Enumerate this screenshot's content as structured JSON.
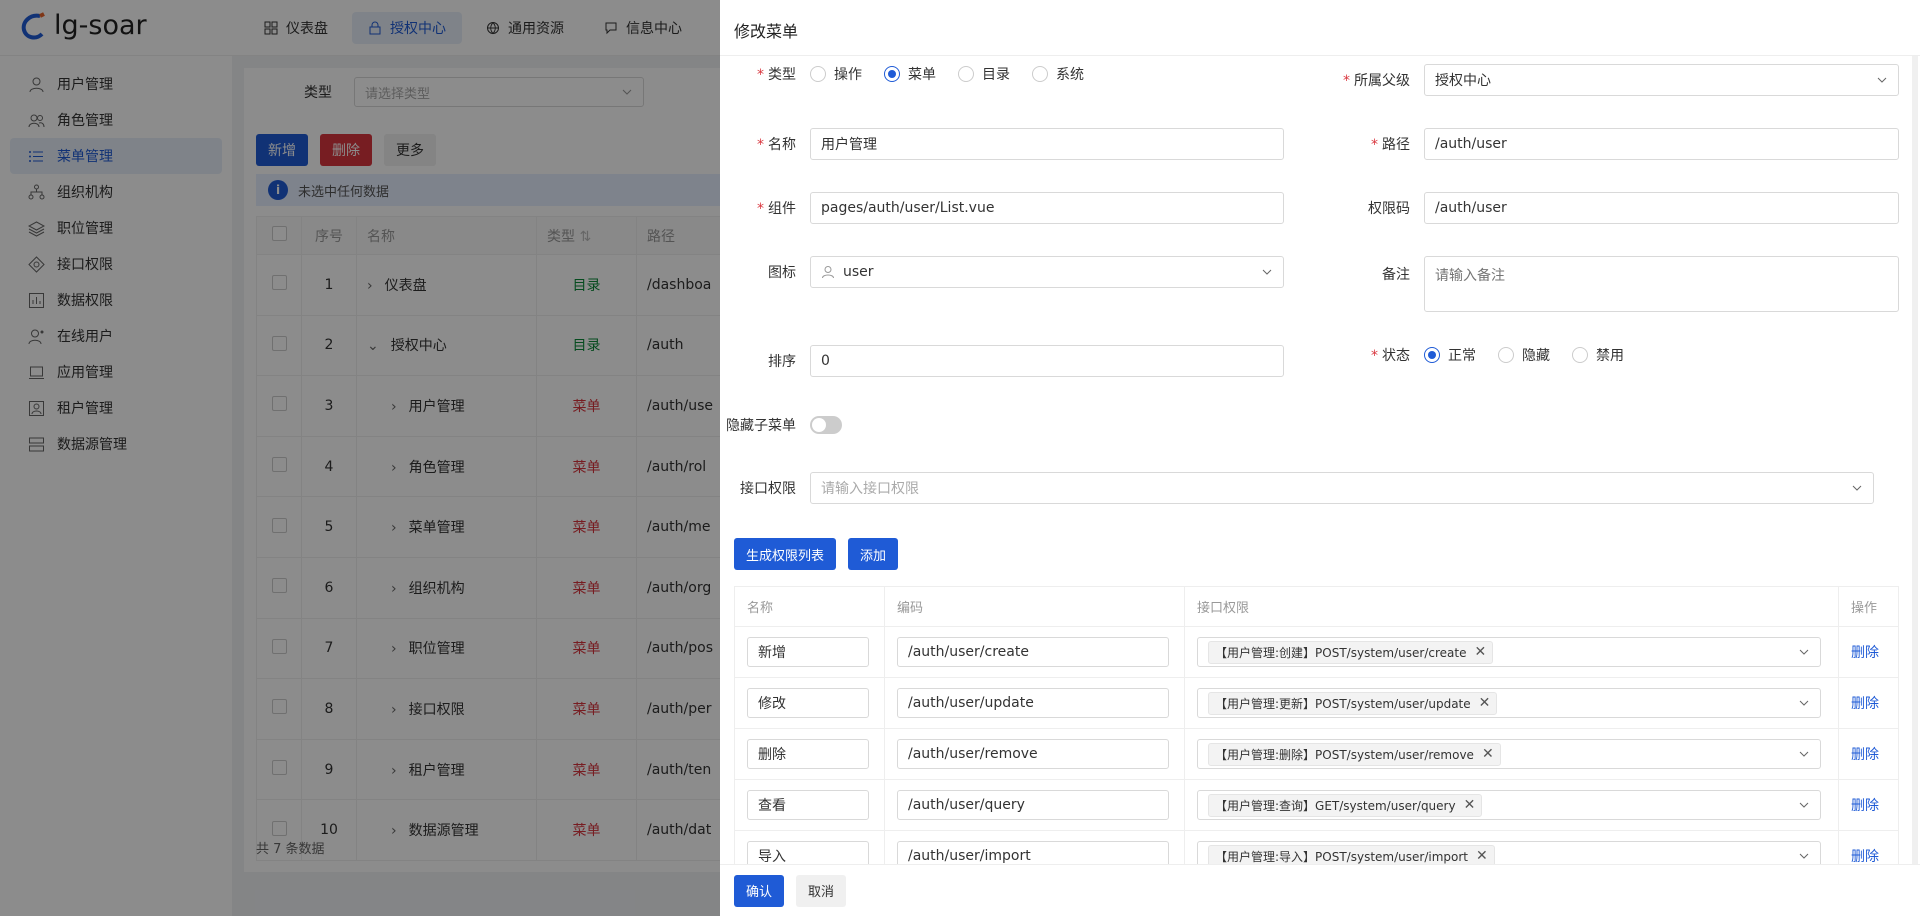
{
  "app": {
    "logo_text": "lg-soar"
  },
  "top_nav": [
    {
      "label": "仪表盘",
      "icon": "dashboard-icon"
    },
    {
      "label": "授权中心",
      "icon": "lock-icon",
      "active": true
    },
    {
      "label": "通用资源",
      "icon": "globe-icon"
    },
    {
      "label": "信息中心",
      "icon": "message-icon"
    }
  ],
  "sidebar": {
    "items": [
      {
        "label": "用户管理",
        "icon": "user-icon"
      },
      {
        "label": "角色管理",
        "icon": "users-icon"
      },
      {
        "label": "菜单管理",
        "icon": "list-icon",
        "active": true
      },
      {
        "label": "组织机构",
        "icon": "org-icon"
      },
      {
        "label": "职位管理",
        "icon": "layers-icon"
      },
      {
        "label": "接口权限",
        "icon": "api-icon"
      },
      {
        "label": "数据权限",
        "icon": "chart-icon"
      },
      {
        "label": "在线用户",
        "icon": "online-user-icon"
      },
      {
        "label": "应用管理",
        "icon": "laptop-icon"
      },
      {
        "label": "租户管理",
        "icon": "tenant-icon"
      },
      {
        "label": "数据源管理",
        "icon": "database-icon"
      }
    ]
  },
  "filter": {
    "type_label": "类型",
    "type_placeholder": "请选择类型"
  },
  "toolbar": {
    "add": "新增",
    "delete": "删除",
    "more": "更多"
  },
  "alert": {
    "text": "未选中任何数据"
  },
  "table": {
    "headers": {
      "index": "序号",
      "name": "名称",
      "type": "类型",
      "path": "路径"
    },
    "rows": [
      {
        "index": "1",
        "name": "仪表盘",
        "type": "目录",
        "path": "/dashboa",
        "expand": "›",
        "indent": 0
      },
      {
        "index": "2",
        "name": "授权中心",
        "type": "目录",
        "path": "/auth",
        "expand": "⌄",
        "indent": 0
      },
      {
        "index": "3",
        "name": "用户管理",
        "type": "菜单",
        "path": "/auth/use",
        "expand": "›",
        "indent": 1
      },
      {
        "index": "4",
        "name": "角色管理",
        "type": "菜单",
        "path": "/auth/rol",
        "expand": "›",
        "indent": 1
      },
      {
        "index": "5",
        "name": "菜单管理",
        "type": "菜单",
        "path": "/auth/me",
        "expand": "›",
        "indent": 1
      },
      {
        "index": "6",
        "name": "组织机构",
        "type": "菜单",
        "path": "/auth/org",
        "expand": "›",
        "indent": 1
      },
      {
        "index": "7",
        "name": "职位管理",
        "type": "菜单",
        "path": "/auth/pos",
        "expand": "›",
        "indent": 1
      },
      {
        "index": "8",
        "name": "接口权限",
        "type": "菜单",
        "path": "/auth/per",
        "expand": "›",
        "indent": 1
      },
      {
        "index": "9",
        "name": "租户管理",
        "type": "菜单",
        "path": "/auth/ten",
        "expand": "›",
        "indent": 1
      },
      {
        "index": "10",
        "name": "数据源管理",
        "type": "菜单",
        "path": "/auth/dat",
        "expand": "›",
        "indent": 1
      }
    ],
    "footer": "共 7 条数据"
  },
  "drawer": {
    "title": "修改菜单",
    "type_label": "类型",
    "type_options": [
      "操作",
      "菜单",
      "目录",
      "系统"
    ],
    "type_selected": "菜单",
    "parent_label": "所属父级",
    "parent_value": "授权中心",
    "name_label": "名称",
    "name_value": "用户管理",
    "path_label": "路径",
    "path_value": "/auth/user",
    "component_label": "组件",
    "component_value": "pages/auth/user/List.vue",
    "perm_code_label": "权限码",
    "perm_code_value": "/auth/user",
    "icon_label": "图标",
    "icon_value": "user",
    "remark_label": "备注",
    "remark_placeholder": "请输入备注",
    "sort_label": "排序",
    "sort_value": "0",
    "status_label": "状态",
    "status_options": [
      "正常",
      "隐藏",
      "禁用"
    ],
    "status_selected": "正常",
    "hide_children_label": "隐藏子菜单",
    "api_label": "接口权限",
    "api_placeholder": "请输入接口权限",
    "gen_button": "生成权限列表",
    "add_button": "添加",
    "perm_table": {
      "headers": {
        "name": "名称",
        "code": "编码",
        "api": "接口权限",
        "action": "操作"
      },
      "rows": [
        {
          "name": "新增",
          "code": "/auth/user/create",
          "api": "【用户管理:创建】POST/system/user/create",
          "action": "删除"
        },
        {
          "name": "修改",
          "code": "/auth/user/update",
          "api": "【用户管理:更新】POST/system/user/update",
          "action": "删除"
        },
        {
          "name": "删除",
          "code": "/auth/user/remove",
          "api": "【用户管理:删除】POST/system/user/remove",
          "action": "删除"
        },
        {
          "name": "查看",
          "code": "/auth/user/query",
          "api": "【用户管理:查询】GET/system/user/query",
          "action": "删除"
        },
        {
          "name": "导入",
          "code": "/auth/user/import",
          "api": "【用户管理:导入】POST/system/user/import",
          "action": "删除"
        }
      ]
    },
    "confirm": "确认",
    "cancel": "取消"
  },
  "colors": {
    "primary": "#1f5bd6",
    "danger": "#d9363e",
    "success": "#0b8a3a"
  }
}
